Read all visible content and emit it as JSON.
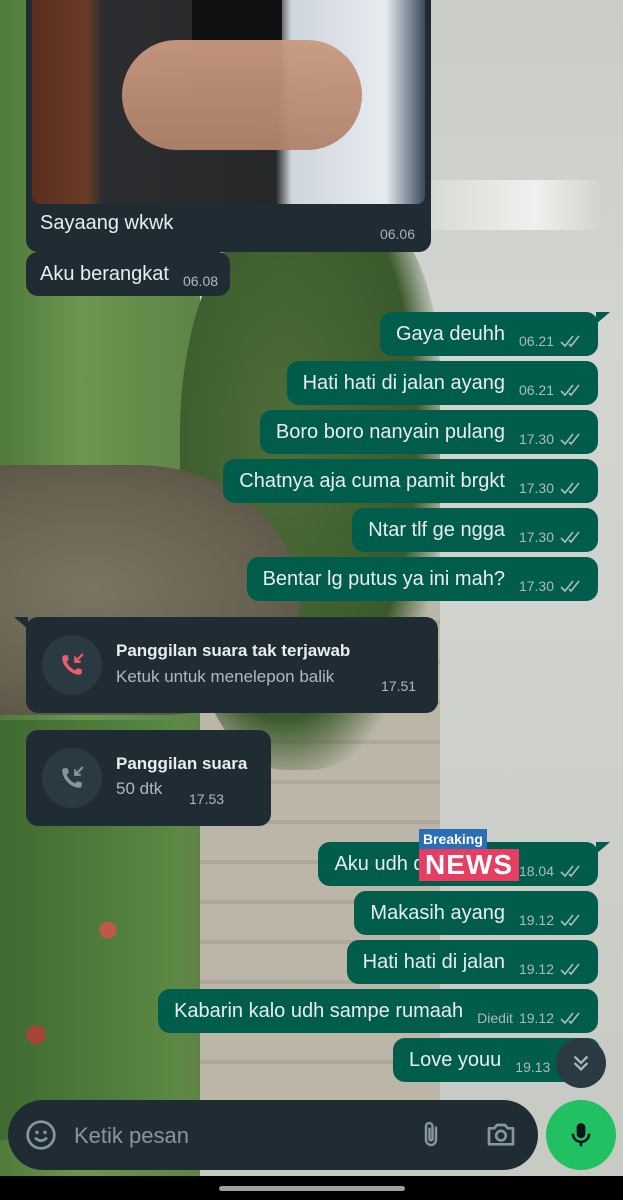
{
  "messages": {
    "image_message": {
      "caption": "Sayaang wkwk",
      "time": "06.06"
    },
    "incoming_1": {
      "text": "Aku berangkat",
      "time": "06.08"
    },
    "out_1": {
      "text": "Gaya deuhh",
      "time": "06.21"
    },
    "out_2": {
      "text": "Hati hati di jalan ayang",
      "time": "06.21"
    },
    "out_3": {
      "text": "Boro boro nanyain pulang",
      "time": "17.30"
    },
    "out_4": {
      "text": "Chatnya aja cuma pamit brgkt",
      "time": "17.30"
    },
    "out_5": {
      "text": "Ntar tlf ge ngga",
      "time": "17.30"
    },
    "out_6": {
      "text": "Bentar lg putus ya ini mah?",
      "time": "17.30"
    },
    "missed_call": {
      "title": "Panggilan suara tak terjawab",
      "subtitle": "Ketuk untuk menelepon balik",
      "time": "17.51"
    },
    "voice_call": {
      "title": "Panggilan suara",
      "subtitle": "50 dtk",
      "time": "17.53"
    },
    "out_7": {
      "text": "Aku udh di",
      "time": "18.04"
    },
    "out_8": {
      "text": "Makasih ayang",
      "time": "19.12"
    },
    "out_9": {
      "text": "Hati hati di jalan",
      "time": "19.12"
    },
    "out_10": {
      "text": "Kabarin kalo udh sampe rumaah",
      "edited": "Diedit",
      "time": "19.12"
    },
    "out_11": {
      "text": "Love youu",
      "time": "19.13"
    }
  },
  "sticker": {
    "top": "Breaking",
    "bottom": "NEWS"
  },
  "composer": {
    "placeholder": "Ketik pesan"
  },
  "icons": {
    "emoji": "emoji-icon",
    "attach": "paperclip-icon",
    "camera": "camera-icon",
    "mic": "mic-icon",
    "scroll": "double-chevron-down-icon",
    "missed_call": "missed-call-icon",
    "incoming_call": "incoming-call-icon",
    "read_receipt": "double-check-icon"
  },
  "colors": {
    "incoming_bubble": "#1f2c34",
    "outgoing_bubble": "#005c4b",
    "accent_green": "#21c063",
    "missed_call_red": "#f15c6d"
  }
}
